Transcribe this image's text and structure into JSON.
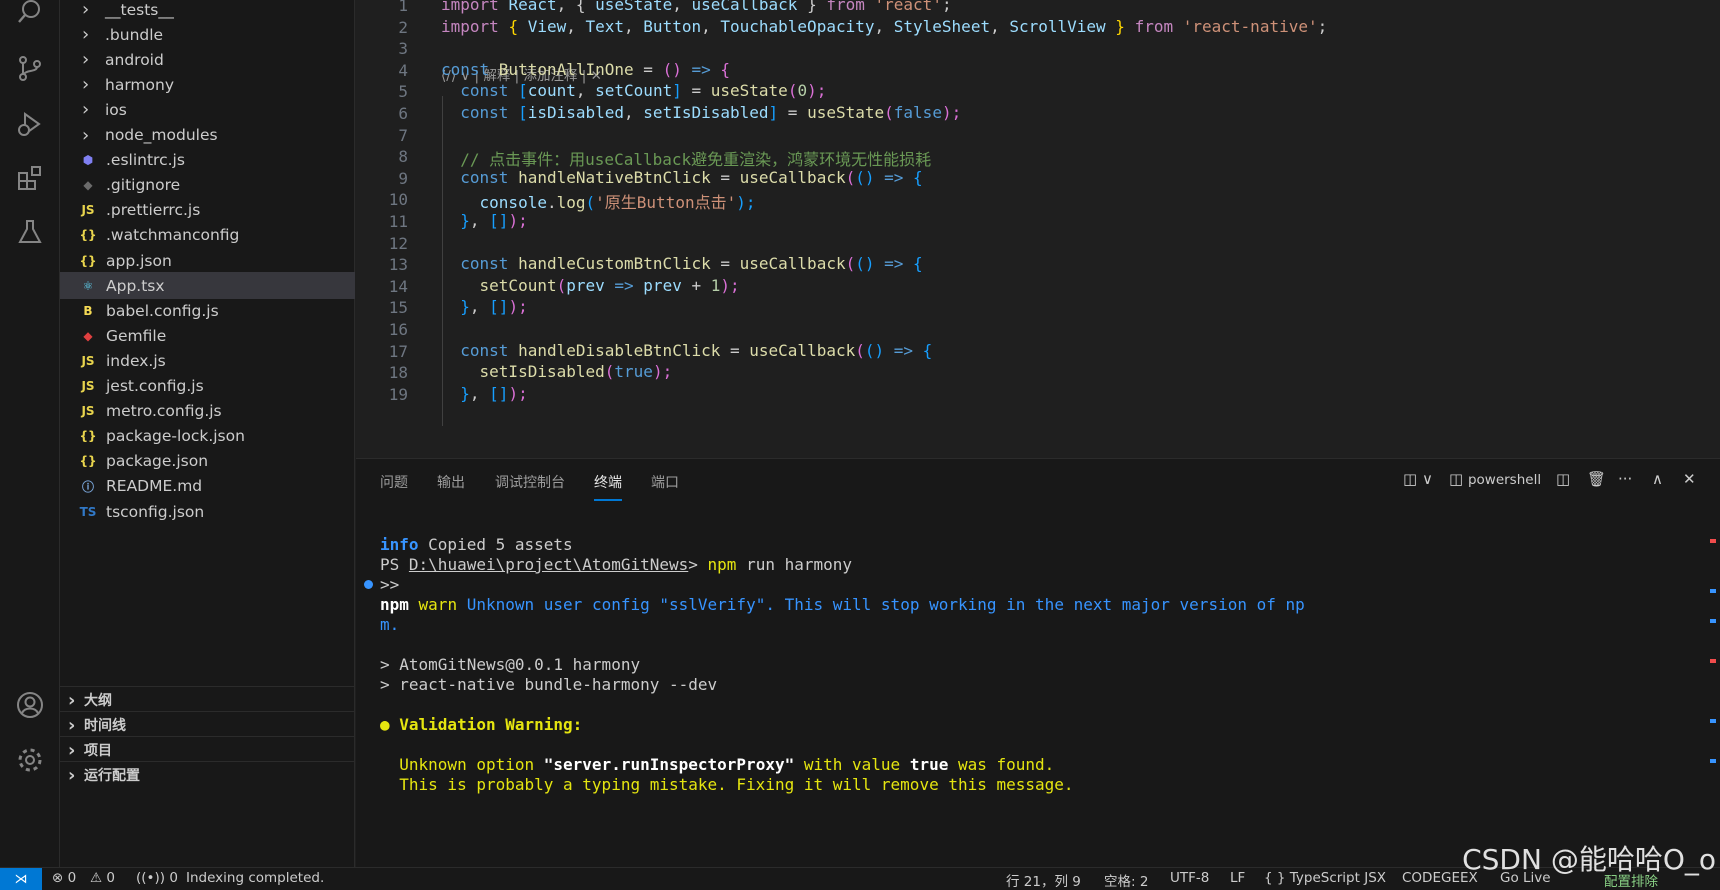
{
  "explorer": {
    "items": [
      {
        "label": "__tests__",
        "kind": "folder"
      },
      {
        "label": ".bundle",
        "kind": "folder"
      },
      {
        "label": "android",
        "kind": "folder"
      },
      {
        "label": "harmony",
        "kind": "folder"
      },
      {
        "label": "ios",
        "kind": "folder"
      },
      {
        "label": "node_modules",
        "kind": "folder"
      },
      {
        "label": ".eslintrc.js",
        "icon": "eslint-icon"
      },
      {
        "label": ".gitignore",
        "icon": "git-icon"
      },
      {
        "label": ".prettierrc.js",
        "icon": "js-icon",
        "glyph": "JS"
      },
      {
        "label": ".watchmanconfig",
        "icon": "json-icon",
        "glyph": "{}"
      },
      {
        "label": "app.json",
        "icon": "json-icon",
        "glyph": "{}"
      },
      {
        "label": "App.tsx",
        "icon": "react-icon",
        "active": true
      },
      {
        "label": "babel.config.js",
        "icon": "babel-icon",
        "glyph": "B"
      },
      {
        "label": "Gemfile",
        "icon": "ruby-icon"
      },
      {
        "label": "index.js",
        "icon": "js-icon",
        "glyph": "JS"
      },
      {
        "label": "jest.config.js",
        "icon": "js-icon",
        "glyph": "JS"
      },
      {
        "label": "metro.config.js",
        "icon": "js-icon",
        "glyph": "JS"
      },
      {
        "label": "package-lock.json",
        "icon": "json-icon",
        "glyph": "{}"
      },
      {
        "label": "package.json",
        "icon": "json-icon",
        "glyph": "{}"
      },
      {
        "label": "README.md",
        "icon": "info-icon",
        "glyph": "ⓘ"
      },
      {
        "label": "tsconfig.json",
        "icon": "ts-icon",
        "glyph": "TS"
      }
    ],
    "sections": [
      "大纲",
      "时间线",
      "项目",
      "运行配置"
    ]
  },
  "editor": {
    "codelens": "⟨/⟩ ∨ | 解释 | 添加注释 | ✕",
    "line_numbers": [
      "1",
      "2",
      "3",
      "4",
      "5",
      "6",
      "7",
      "8",
      "9",
      "10",
      "11",
      "12",
      "13",
      "14",
      "15",
      "16",
      "17",
      "18",
      "19"
    ],
    "code": {
      "l1": [
        "import ",
        "React",
        ", { ",
        "useState",
        ", ",
        "useCallback",
        " } ",
        "from ",
        "'react'",
        ";"
      ],
      "l2": [
        "import ",
        "{ ",
        "View",
        ", ",
        "Text",
        ", ",
        "Button",
        ", ",
        "TouchableOpacity",
        ", ",
        "StyleSheet",
        ", ",
        "ScrollView",
        " } ",
        "from ",
        "'react-native'",
        ";"
      ],
      "l4": [
        "const ",
        "ButtonAllInOne",
        " = ",
        "()",
        " => ",
        "{"
      ],
      "l5": [
        "  const ",
        "[",
        "count",
        ", ",
        "setCount",
        "]",
        " = ",
        "useState",
        "(",
        "0",
        ");"
      ],
      "l6": [
        "  const ",
        "[",
        "isDisabled",
        ", ",
        "setIsDisabled",
        "]",
        " = ",
        "useState",
        "(",
        "false",
        ");"
      ],
      "l8": [
        "  // 点击事件：用useCallback避免重渲染，鸿蒙环境无性能损耗"
      ],
      "l9": [
        "  const ",
        "handleNativeBtnClick",
        " = ",
        "useCallback",
        "(",
        "()",
        " => ",
        "{"
      ],
      "l10": [
        "    console",
        ".",
        "log",
        "(",
        "'原生Button点击'",
        ");"
      ],
      "l11": [
        "  }",
        ", ",
        "[]",
        ");"
      ],
      "l13": [
        "  const ",
        "handleCustomBtnClick",
        " = ",
        "useCallback",
        "(",
        "()",
        " => ",
        "{"
      ],
      "l14": [
        "    ",
        "setCount",
        "(",
        "prev",
        " => ",
        "prev",
        " + ",
        "1",
        ");"
      ],
      "l15": [
        "  }",
        ", ",
        "[]",
        ");"
      ],
      "l17": [
        "  const ",
        "handleDisableBtnClick",
        " = ",
        "useCallback",
        "(",
        "()",
        " => ",
        "{"
      ],
      "l18": [
        "    ",
        "setIsDisabled",
        "(",
        "true",
        ");"
      ],
      "l19": [
        "  }",
        ", ",
        "[]",
        ");"
      ]
    }
  },
  "panel": {
    "tabs": [
      "问题",
      "输出",
      "调试控制台",
      "终端",
      "端口"
    ],
    "active_tab": "终端",
    "shell": "powershell",
    "terminal": {
      "t1a": "info",
      "t1b": " Copied 5 assets",
      "t2a": "PS ",
      "t2b": "D:\\huawei\\project\\AtomGitNews",
      "t2c": "> ",
      "t2d": "npm",
      "t2e": " run harmony",
      "t3": ">>",
      "t4a": "npm",
      "t4b": " warn",
      "t4c": " Unknown user config \"sslVerify\". This will stop working in the next major version of np",
      "t5": "m.",
      "t6": "> AtomGitNews@0.0.1 harmony",
      "t7": "> react-native bundle-harmony --dev",
      "t8a": "● ",
      "t8b": "Validation Warning:",
      "t9a": "  Unknown option ",
      "t9b": "\"server.runInspectorProxy\"",
      "t9c": " with value ",
      "t9d": "true",
      "t9e": " was found.",
      "t10": "  This is probably a typing mistake. Fixing it will remove this message."
    }
  },
  "status": {
    "errors": "⊗ 0",
    "warnings": "⚠ 0",
    "ports": "((•)) 0",
    "indexing": "Indexing completed.",
    "position": "行 21，列 9",
    "spaces": "空格: 2",
    "encoding": "UTF-8",
    "eol": "LF",
    "language": "{ } TypeScript JSX",
    "codegeex": "CODEGEEX",
    "golive": "Go Live",
    "extra": "配置排除"
  },
  "watermark": "CSDN @能哈哈O_o",
  "colors": {
    "accent": "#0078d4",
    "bg": "#1f1f1f",
    "sidebar": "#181818",
    "selection": "#37373d"
  }
}
